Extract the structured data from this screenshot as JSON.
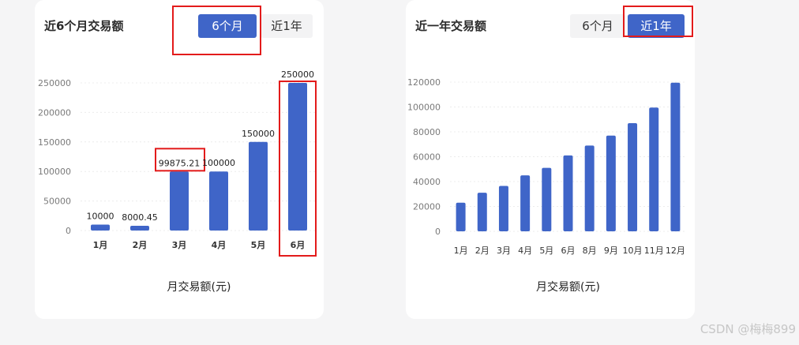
{
  "panel_left": {
    "title": "近6个月交易额",
    "tabs": [
      {
        "label": "6个月",
        "active": true
      },
      {
        "label": "近1年",
        "active": false
      }
    ]
  },
  "panel_right": {
    "title": "近一年交易额",
    "tabs": [
      {
        "label": "6个月",
        "active": false
      },
      {
        "label": "近1年",
        "active": true
      }
    ]
  },
  "colors": {
    "bar": "#3f65c8",
    "highlight": "#e31b1b",
    "tab_active": "#3f65c8"
  },
  "watermark": "CSDN @梅梅899",
  "chart_data": [
    {
      "type": "bar",
      "categories": [
        "1月",
        "2月",
        "3月",
        "4月",
        "5月",
        "6月"
      ],
      "values": [
        10000,
        8000.45,
        99875.21,
        100000,
        150000,
        250000
      ],
      "data_labels": [
        "10000",
        "8000.45",
        "99875.21",
        "100000",
        "150000",
        "250000"
      ],
      "yticks": [
        "0",
        "50000",
        "100000",
        "150000",
        "200000",
        "250000"
      ],
      "ylim": [
        0,
        250000
      ],
      "xlabel": "月交易额(元)",
      "bold_x_ticks": true,
      "highlighted_indices": [
        2,
        5
      ]
    },
    {
      "type": "bar",
      "categories": [
        "1月",
        "2月",
        "3月",
        "4月",
        "5月",
        "6月",
        "8月",
        "9月",
        "10月",
        "11月",
        "12月"
      ],
      "values": [
        23000,
        31000,
        36500,
        45000,
        51000,
        61000,
        69000,
        77000,
        87000,
        99500,
        119500
      ],
      "yticks": [
        "0",
        "20000",
        "40000",
        "60000",
        "80000",
        "100000",
        "120000"
      ],
      "ylim": [
        0,
        120000
      ],
      "xlabel": "月交易额(元)"
    }
  ]
}
